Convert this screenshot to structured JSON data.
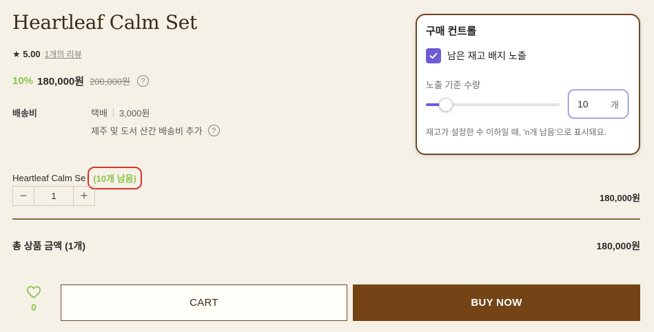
{
  "product": {
    "title": "Heartleaf Calm Set",
    "rating": "★ 5.00",
    "review_link": "1개의 리뷰",
    "discount": "10%",
    "price": "180,000원",
    "original_price": "200,000원"
  },
  "shipping": {
    "label": "배송비",
    "method": "택배",
    "fee": "3,000원",
    "note": "제주 및 도서 산간 배송비 추가"
  },
  "option": {
    "name": "Heartleaf Calm Se",
    "stock_badge": "(10개 남음)",
    "quantity": "1",
    "line_price": "180,000원"
  },
  "total": {
    "label": "총 상품 금액 (1개)",
    "value": "180,000원"
  },
  "actions": {
    "wish_count": "0",
    "cart_label": "CART",
    "buy_label": "BUY NOW"
  },
  "control_panel": {
    "title": "구매 컨트롤",
    "checkbox_label": "남은 재고 배지 노출",
    "checkbox_checked": true,
    "threshold_label": "노출 기준 수량",
    "threshold_value": "10",
    "threshold_unit": "개",
    "slider_fraction": 0.13,
    "hint": "재고가 설정한 수 이하일 때, 'n개 남음'으로 표시돼요."
  },
  "colors": {
    "accent_green": "#8bc34a",
    "brand_brown": "#744416",
    "control_purple": "#6f5bd6",
    "highlight_red": "#d9302c"
  }
}
